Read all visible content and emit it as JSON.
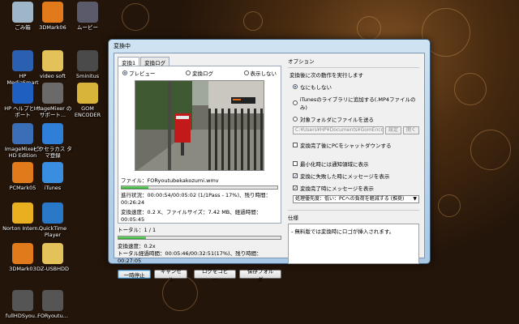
{
  "desktop": {
    "icons": [
      {
        "label": "ごみ箱",
        "icon": "recycle-bin-icon",
        "color": "#9fb6c9"
      },
      {
        "label": "3DMark06",
        "icon": "3dmark-icon",
        "color": "#e07a1a"
      },
      {
        "label": "ムービー",
        "icon": "movie-icon",
        "color": "#5a5a6a"
      },
      {
        "label": "HP MediaSmart",
        "icon": "hp-mediasmart-icon",
        "color": "#2b5fb0"
      },
      {
        "label": "video soft",
        "icon": "folder-icon",
        "color": "#e3c25a"
      },
      {
        "label": "5minitus",
        "icon": "app-icon",
        "color": "#4a4a4a"
      },
      {
        "label": "HP ヘルプと サポート",
        "icon": "help-icon",
        "color": "#1f5fbf"
      },
      {
        "label": "ImageMixer のサポート...",
        "icon": "imagemixer-icon",
        "color": "#6a6a6a"
      },
      {
        "label": "GOM ENCODER",
        "icon": "gom-encoder-icon",
        "color": "#d8b43a"
      },
      {
        "label": "ImageMixer 3 HD Edition",
        "icon": "imagemixer-icon",
        "color": "#3a6fb8"
      },
      {
        "label": "ピクセラカス タマ登録",
        "icon": "ie-icon",
        "color": "#2f7fd8"
      },
      {
        "label": "PCMark05",
        "icon": "pcmark-icon",
        "color": "#e07a1a"
      },
      {
        "label": "iTunes",
        "icon": "itunes-icon",
        "color": "#3a8ee0"
      },
      {
        "label": "Norton Intern...",
        "icon": "norton-icon",
        "color": "#e8b020"
      },
      {
        "label": "QuickTime Player",
        "icon": "quicktime-icon",
        "color": "#2a78c8"
      },
      {
        "label": "3DMark03",
        "icon": "3dmark-icon",
        "color": "#e07a1a"
      },
      {
        "label": "DZ-USBHDD",
        "icon": "folder-icon",
        "color": "#e3c25a"
      },
      {
        "label": "fullHDSyou...",
        "icon": "video-file-icon",
        "color": "#555555"
      },
      {
        "label": "FORyoutu...",
        "icon": "video-file-icon",
        "color": "#555555"
      }
    ]
  },
  "window": {
    "title": "変換中",
    "tabs": [
      {
        "label": "変換1"
      },
      {
        "label": "変換ログ"
      }
    ],
    "view_options": [
      {
        "label": "プレビュー",
        "selected": true
      },
      {
        "label": "変換ログ",
        "selected": false
      },
      {
        "label": "表示しない",
        "selected": false
      }
    ],
    "file_label": "ファイル：FORyoutubekakozumi.wmv",
    "file_progress": 0.17,
    "progress_text": "進行状況：00:00:54/00:05:02 (1/1Pass - 17%)、残り時間：00:26:24",
    "speed_text": "変換速度：0.2 X、ファイルサイズ：7.42 MB、経過時間：00:05:45",
    "total_label": "トータル：1 / 1",
    "total_progress": 0.17,
    "total_speed": "変換速度：0.2x",
    "total_elapsed": "トータル経過時間：00:05:46/00:32:51(17%)、残り時間：00:27:05",
    "buttons": {
      "pause": "一時停止",
      "cancel": "キャンセル",
      "copy_log": "ログをコピー",
      "save_folder": "保存フォルダ"
    },
    "options": {
      "title": "オプション",
      "after_label": "変換後に次の動作を実行します",
      "radios": [
        {
          "label": "なにもしない",
          "selected": true
        },
        {
          "label": "iTunesのライブラリに追加する(.MP4ファイルのみ)",
          "selected": false
        },
        {
          "label": "対象フォルダにファイルを送る",
          "selected": false
        }
      ],
      "path": "C:¥Users¥HP¥Documents¥GomEncoder¥",
      "path_settings": "設定",
      "path_open": "開く",
      "shutdown_label": "変換完了後にPCをシャットダウンする",
      "checks": [
        {
          "label": "最小化時には通知領域に表示",
          "checked": false
        },
        {
          "label": "変換に失敗した時にメッセージを表示",
          "checked": true
        },
        {
          "label": "変換完了時にメッセージを表示",
          "checked": true
        }
      ],
      "priority": "処理優先度：低い：PCへの負荷を軽減する (推奨)"
    },
    "spec": {
      "title": "仕様",
      "text": "- 無料版では変換時にロゴが挿入されます。"
    }
  }
}
